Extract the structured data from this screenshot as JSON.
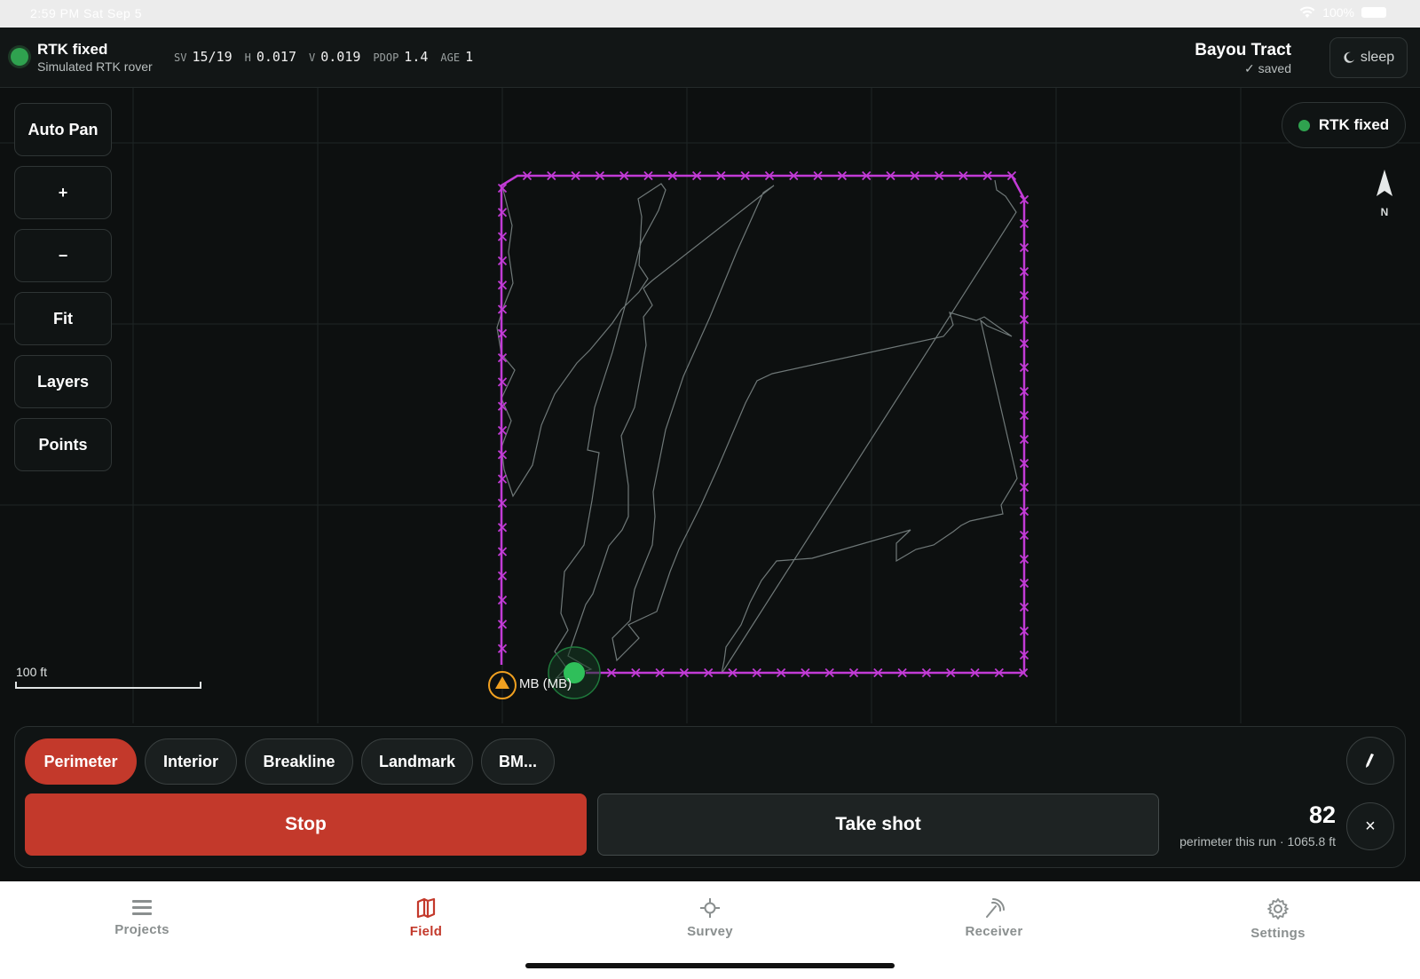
{
  "status_bar": {
    "time": "2:59 PM  Sat Sep 5",
    "battery": "100%"
  },
  "header": {
    "fix_status": "RTK fixed",
    "fix_source": "Simulated RTK rover",
    "metrics": [
      {
        "key": "SV",
        "value": "15/19"
      },
      {
        "key": "H",
        "value": "0.017"
      },
      {
        "key": "V",
        "value": "0.019"
      },
      {
        "key": "PDOP",
        "value": "1.4"
      },
      {
        "key": "AGE",
        "value": "1"
      }
    ],
    "project_name": "Bayou Tract",
    "project_state": "✓ saved",
    "sleep_label": "sleep"
  },
  "map": {
    "controls": {
      "auto_pan": "Auto Pan",
      "zoom_in": "+",
      "zoom_out": "−",
      "fit": "Fit",
      "layers": "Layers",
      "points": "Points"
    },
    "rtk_badge": "RTK fixed",
    "north_label": "N",
    "scale_label": "100 ft",
    "base_marker_label": "MB (MB)",
    "colors": {
      "perimeter": "#c23bd6",
      "rover": "#2fbf5a",
      "base": "#f0a020",
      "track": "#6f7878"
    }
  },
  "capture": {
    "categories": [
      "Perimeter",
      "Interior",
      "Breakline",
      "Landmark",
      "BM..."
    ],
    "active_category": "Perimeter",
    "stop_label": "Stop",
    "shot_label": "Take shot",
    "count": "82",
    "count_caption": "perimeter this run · 1065.8 ft",
    "close_label": "×"
  },
  "tabs": [
    {
      "label": "Projects",
      "icon": "list-icon"
    },
    {
      "label": "Field",
      "icon": "map-icon",
      "active": true
    },
    {
      "label": "Survey",
      "icon": "crosshair-icon"
    },
    {
      "label": "Receiver",
      "icon": "antenna-icon"
    },
    {
      "label": "Settings",
      "icon": "gear-icon"
    }
  ]
}
